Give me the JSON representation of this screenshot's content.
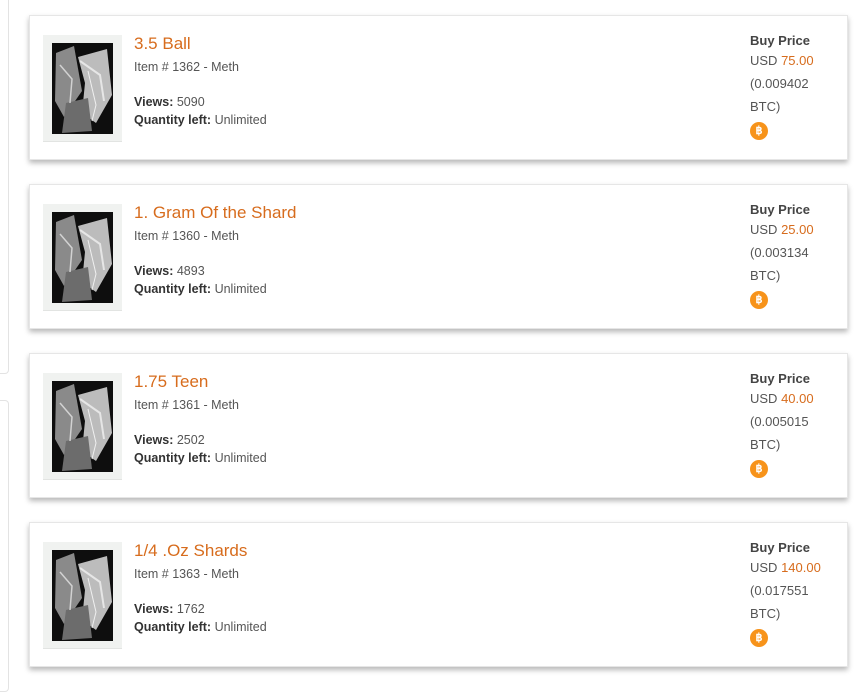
{
  "colors": {
    "accent": "#d76c1d",
    "bitcoin": "#f7931a"
  },
  "listings": [
    {
      "title": "3.5 Ball",
      "item_line": "Item # 1362 - Meth",
      "views_label": "Views:",
      "views": "5090",
      "qty_label": "Quantity left:",
      "qty": "Unlimited",
      "buy_label": "Buy Price",
      "currency": "USD",
      "usd": "75.00",
      "btc_open": "(0.009402",
      "btc_close": "BTC)",
      "btc_icon": "bitcoin-icon",
      "btc_symbol": "฿"
    },
    {
      "title": "1. Gram Of the Shard",
      "item_line": "Item # 1360 - Meth",
      "views_label": "Views:",
      "views": "4893",
      "qty_label": "Quantity left:",
      "qty": "Unlimited",
      "buy_label": "Buy Price",
      "currency": "USD",
      "usd": "25.00",
      "btc_open": "(0.003134",
      "btc_close": "BTC)",
      "btc_icon": "bitcoin-icon",
      "btc_symbol": "฿"
    },
    {
      "title": "1.75 Teen",
      "item_line": "Item # 1361 - Meth",
      "views_label": "Views:",
      "views": "2502",
      "qty_label": "Quantity left:",
      "qty": "Unlimited",
      "buy_label": "Buy Price",
      "currency": "USD",
      "usd": "40.00",
      "btc_open": "(0.005015",
      "btc_close": "BTC)",
      "btc_icon": "bitcoin-icon",
      "btc_symbol": "฿"
    },
    {
      "title": "1/4 .Oz Shards",
      "item_line": "Item # 1363 - Meth",
      "views_label": "Views:",
      "views": "1762",
      "qty_label": "Quantity left:",
      "qty": "Unlimited",
      "buy_label": "Buy Price",
      "currency": "USD",
      "usd": "140.00",
      "btc_open": "(0.017551",
      "btc_close": "BTC)",
      "btc_icon": "bitcoin-icon",
      "btc_symbol": "฿"
    }
  ]
}
